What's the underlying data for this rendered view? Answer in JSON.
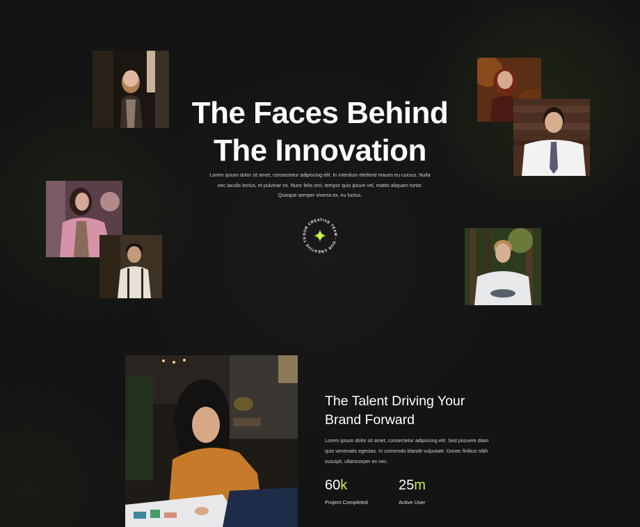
{
  "hero": {
    "title_line1": "The Faces Behind",
    "title_line2": "The Innovation",
    "description": "Lorem ipsum dolor sit amet, consectetur adipiscing elit. In interdum eleifend mauris eu cursus. Nulla nec iaculis lectus, et pulvinar mi. Nunc felis orci, tempor quis ipsum vel, mattis aliquam tortor. Quisque semper viverra ex, eu luctus.",
    "badge_text": "OUR CREATIVE TEAM - OUR CREATIVE TEAM - "
  },
  "talent": {
    "title_line1": "The Talent Driving Your",
    "title_line2": "Brand Forward",
    "description": "Lorem ipsum dolor sit amet, consectetur adipiscing elit. Sed posuere diam quis venenatis egestas. In commodo blandit vulputate. Donec finibus nibh suscipit, ullamcorper ex nec.",
    "stats": [
      {
        "number": "60",
        "suffix": "k",
        "label": "Project Completed"
      },
      {
        "number": "25",
        "suffix": "m",
        "label": "Active User"
      }
    ]
  },
  "colors": {
    "background": "#141414",
    "accent": "#c6f24a",
    "text": "#ffffff",
    "muted_text": "#d0d0d0"
  }
}
